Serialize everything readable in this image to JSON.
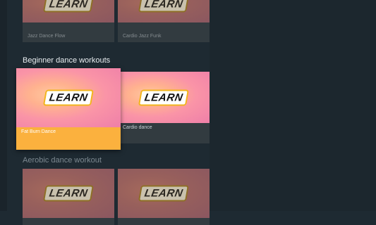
{
  "thumbnail_label": "LEARN",
  "rows": [
    {
      "title": "",
      "cards": [
        {
          "caption": "Jazz Dance Flow"
        },
        {
          "caption": "Cardio Jazz Funk"
        }
      ]
    },
    {
      "title": "Beginner dance workouts",
      "cards": [
        {
          "caption": "Fat Burn Dance",
          "focused": true
        },
        {
          "caption": "Cardio dance"
        }
      ]
    },
    {
      "title": "Aerobic dance workout",
      "cards": [
        {
          "caption": ""
        },
        {
          "caption": ""
        }
      ]
    }
  ],
  "colors": {
    "background": "#1e2a32",
    "focus_accent": "#fbb13e",
    "learn_badge_border": "#f2b51c"
  }
}
